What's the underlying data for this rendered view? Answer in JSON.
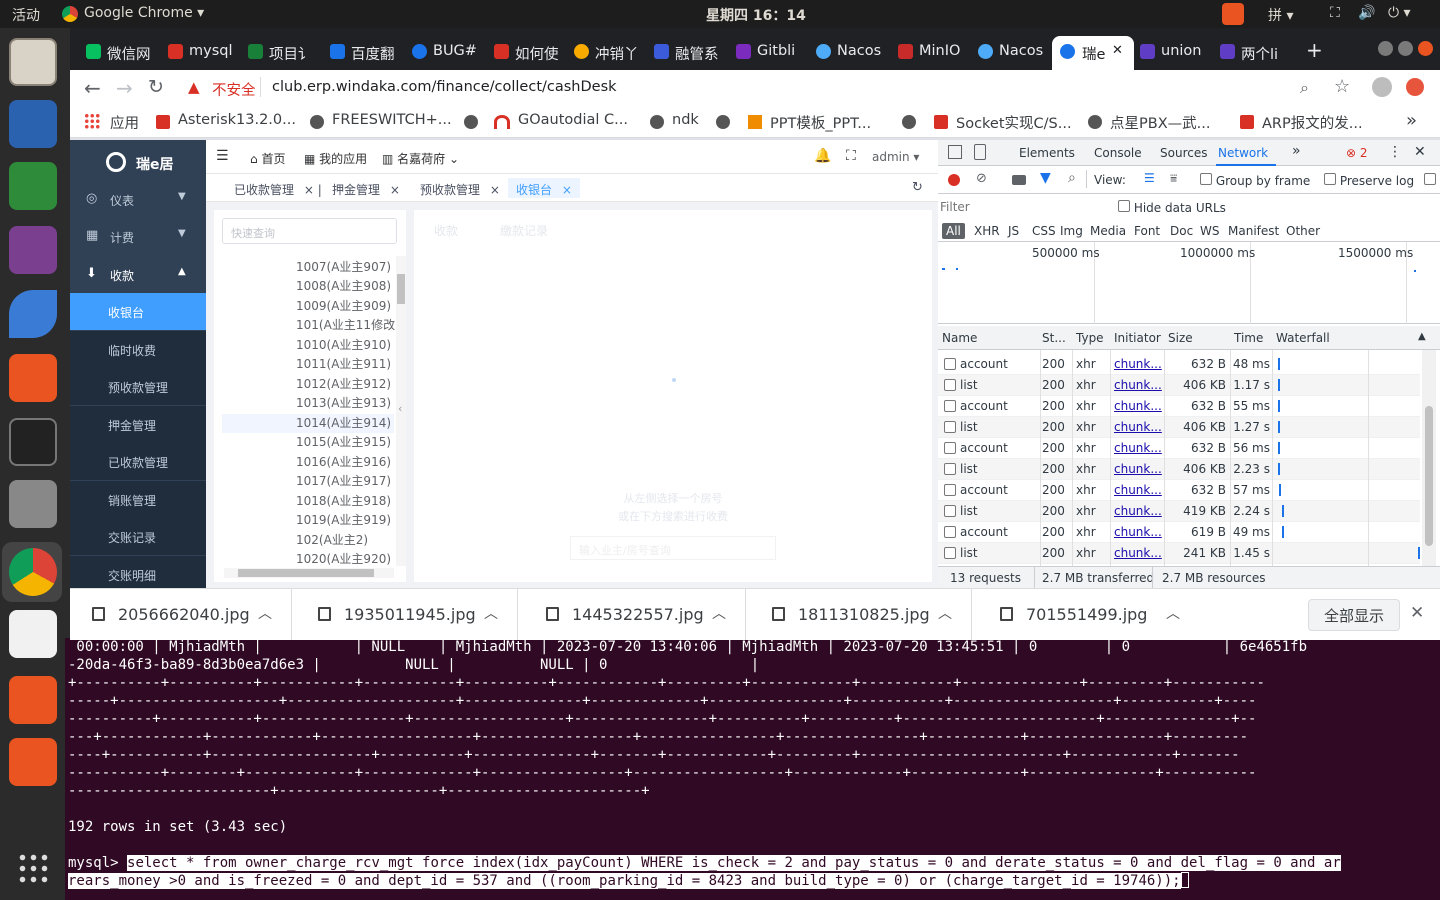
{
  "system": {
    "activities": "活动",
    "app_name": "Google Chrome",
    "clock": "星期四 16：14",
    "ime": "拼"
  },
  "tabs": [
    {
      "label": "微信网",
      "color": "#07c160"
    },
    {
      "label": "mysql",
      "color": "#d93025"
    },
    {
      "label": "项目讠",
      "color": "#188038"
    },
    {
      "label": "百度翻",
      "color": "#1a73e8"
    },
    {
      "label": "BUG#",
      "color": "#1a73e8"
    },
    {
      "label": "如何使",
      "color": "#d93025"
    },
    {
      "label": "冲销丫",
      "color": "#f9ab00"
    },
    {
      "label": "融管系",
      "color": "#3b5bdb"
    },
    {
      "label": "Gitbli",
      "color": "#7b2cbf"
    },
    {
      "label": "Nacos",
      "color": "#4dabf7"
    },
    {
      "label": "MinIO",
      "color": "#c92a2a"
    },
    {
      "label": "Nacos",
      "color": "#4dabf7"
    },
    {
      "label": "瑞e",
      "color": "#1a73e8"
    },
    {
      "label": "union",
      "color": "#5f3dc4"
    },
    {
      "label": "两个li",
      "color": "#5f3dc4"
    }
  ],
  "address": {
    "insecure": "不安全",
    "url": "club.erp.windaka.com/finance/collect/cashDesk"
  },
  "bookmarks": [
    "应用",
    "Asterisk13.2.0...",
    "FREESWITCH+...",
    "GOautodial C...",
    "ndk",
    "PPT模板_PPT...",
    "Socket实现C/S...",
    "点星PBX—武...",
    "ARP报文的发..."
  ],
  "app": {
    "brand": "瑞e居",
    "nav": [
      {
        "label": "仪表",
        "icon": "gauge-icon"
      },
      {
        "label": "计费",
        "icon": "grid-icon"
      },
      {
        "label": "收款",
        "icon": "download-icon"
      }
    ],
    "sub_nav": [
      "收银台",
      "临时收费",
      "预收款管理",
      "押金管理",
      "已收款管理",
      "销账管理",
      "交账记录",
      "交账明细"
    ],
    "header": {
      "home": "首页",
      "my_apps": "我的应用",
      "estate": "名嘉荷府",
      "user": "admin"
    },
    "page_tabs": [
      "已收款管理",
      "押金管理",
      "预收款管理",
      "收银台"
    ],
    "search_placeholder": "快速查询",
    "rooms": [
      "1007(A业主907)",
      "1008(A业主908)",
      "1009(A业主909)",
      "101(A业主11修改",
      "1010(A业主910)",
      "1011(A业主911)",
      "1012(A业主912)",
      "1013(A业主913)",
      "1014(A业主914)",
      "1015(A业主915)",
      "1016(A业主916)",
      "1017(A业主917)",
      "1018(A业主918)",
      "1019(A业主919)",
      "102(A业主2)",
      "1020(A业主920)"
    ],
    "content_tabs": [
      "收款",
      "缴款记录"
    ],
    "hint_line1": "从左侧选择一个房号",
    "hint_line2": "或在下方搜索进行收费",
    "search_hint": "输入业主/房号查询"
  },
  "devtools": {
    "tabs": [
      "Elements",
      "Console",
      "Sources",
      "Network"
    ],
    "errors": "2",
    "view_label": "View:",
    "group_by_frame": "Group by frame",
    "preserve_log": "Preserve log",
    "filter_placeholder": "Filter",
    "hide_data_urls": "Hide data URLs",
    "types": [
      "All",
      "XHR",
      "JS",
      "CSS",
      "Img",
      "Media",
      "Font",
      "Doc",
      "WS",
      "Manifest",
      "Other"
    ],
    "timeline": [
      "500000 ms",
      "1000000 ms",
      "1500000 ms"
    ],
    "columns": [
      "Name",
      "St...",
      "Type",
      "Initiator",
      "Size",
      "Time",
      "Waterfall"
    ],
    "rows": [
      {
        "name": "account",
        "status": "200",
        "type": "xhr",
        "initiator": "chunk...",
        "size": "632 B",
        "time": "48 ms"
      },
      {
        "name": "list",
        "status": "200",
        "type": "xhr",
        "initiator": "chunk...",
        "size": "406 KB",
        "time": "1.17 s"
      },
      {
        "name": "account",
        "status": "200",
        "type": "xhr",
        "initiator": "chunk...",
        "size": "632 B",
        "time": "55 ms"
      },
      {
        "name": "list",
        "status": "200",
        "type": "xhr",
        "initiator": "chunk...",
        "size": "406 KB",
        "time": "1.27 s"
      },
      {
        "name": "account",
        "status": "200",
        "type": "xhr",
        "initiator": "chunk...",
        "size": "632 B",
        "time": "56 ms"
      },
      {
        "name": "list",
        "status": "200",
        "type": "xhr",
        "initiator": "chunk...",
        "size": "406 KB",
        "time": "2.23 s"
      },
      {
        "name": "account",
        "status": "200",
        "type": "xhr",
        "initiator": "chunk...",
        "size": "632 B",
        "time": "57 ms"
      },
      {
        "name": "list",
        "status": "200",
        "type": "xhr",
        "initiator": "chunk...",
        "size": "419 KB",
        "time": "2.24 s"
      },
      {
        "name": "account",
        "status": "200",
        "type": "xhr",
        "initiator": "chunk...",
        "size": "619 B",
        "time": "49 ms"
      },
      {
        "name": "list",
        "status": "200",
        "type": "xhr",
        "initiator": "chunk...",
        "size": "241 KB",
        "time": "1.45 s"
      }
    ],
    "summary": {
      "requests": "13 requests",
      "transferred": "2.7 MB transferred",
      "resources": "2.7 MB resources"
    }
  },
  "downloads": {
    "files": [
      "2056662040.jpg",
      "1935011945.jpg",
      "1445322557.jpg",
      "1811310825.jpg",
      "701551499.jpg"
    ],
    "show_all": "全部显示"
  },
  "terminal": {
    "lines": [
      " 00:00:00 | MjhiadMth |           | NULL    | MjhiadMth | 2023-07-20 13:40:06 | MjhiadMth | 2023-07-20 13:45:51 | 0        | 0           | 6e4651fb",
      "-20da-46f3-ba89-8d3b0ea7d6e3 |          NULL |          NULL | 0                 |",
      "+----------+----------+-----------+-----------+----------+------------+---------+------------+-----------+--------------+---------+-----------",
      "-----+-------------------+--------------------+--------------+-------------+----------------+-----------+-------------------+-----------+----",
      "----------+-----------+-----------------+------------------+----------------+----------+----------+-----------------------+---------------+--",
      "---+------------+------------+------------------+------------------+----------------+----------------+-----------+----------------+---------",
      "----+-----------+-------------------+----------+--------------+-------+------------+---------+------------------------+------------+-------",
      "-----------+--------+-------------+-------------+-----------------+------------------+-------------+-------------+---------------+-----------",
      "------------------------+-------------------+-----------------------+",
      "192 rows in set (3.43 sec)"
    ],
    "prompt": "mysql> ",
    "cmd1": "select * from owner_charge_rcv_mgt force index(idx_payCount) WHERE is_check = 2 and pay_status = 0 and derate_status = 0 and del_flag = 0 and ar",
    "cmd2": "rears_money >0 and is_freezed = 0 and dept_id = 537 and ((room_parking_id = 8423 and build_type = 0) or (charge_target_id = 19746));"
  }
}
